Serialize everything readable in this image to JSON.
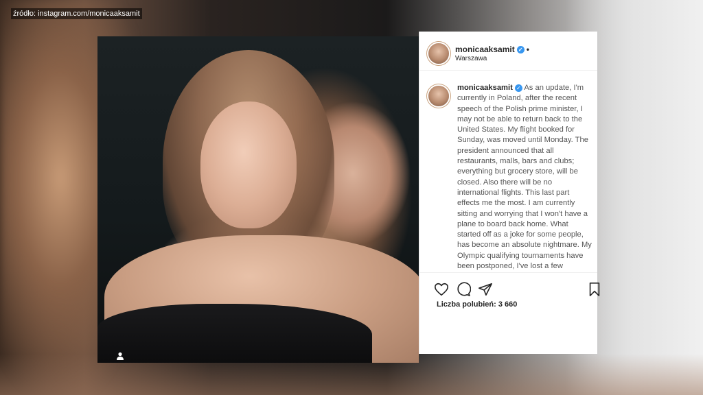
{
  "source_label": "źródło: instagram.com/monicaaksamit",
  "post": {
    "username": "monicaaksamit",
    "location": "Warszawa",
    "more": "•",
    "verified": "✓",
    "caption": "As an update, I'm currently in Poland, after the recent speech of the Polish prime minister, I may not be able to return back to the United States. My flight booked for Sunday, was moved until Monday. The president announced that all restaurants, malls, bars and clubs; everything but grocery store, will be closed. Also there will be no international flights. This last part effects me the most. I am currently sitting and worrying that I won't have a plane to board back home. What started off as a joke for some people, has become an absolute nightmare. My Olympic qualifying tournaments have been postponed, I've lost a few thousand dollars on this trip. But my biggest concern is returning back",
    "likes_text": "Liczba polubień: 3 660",
    "icons": {
      "like": "heart-icon",
      "comment": "comment-icon",
      "share": "share-icon",
      "save": "bookmark-icon",
      "tagged": "user-tag-icon"
    }
  }
}
